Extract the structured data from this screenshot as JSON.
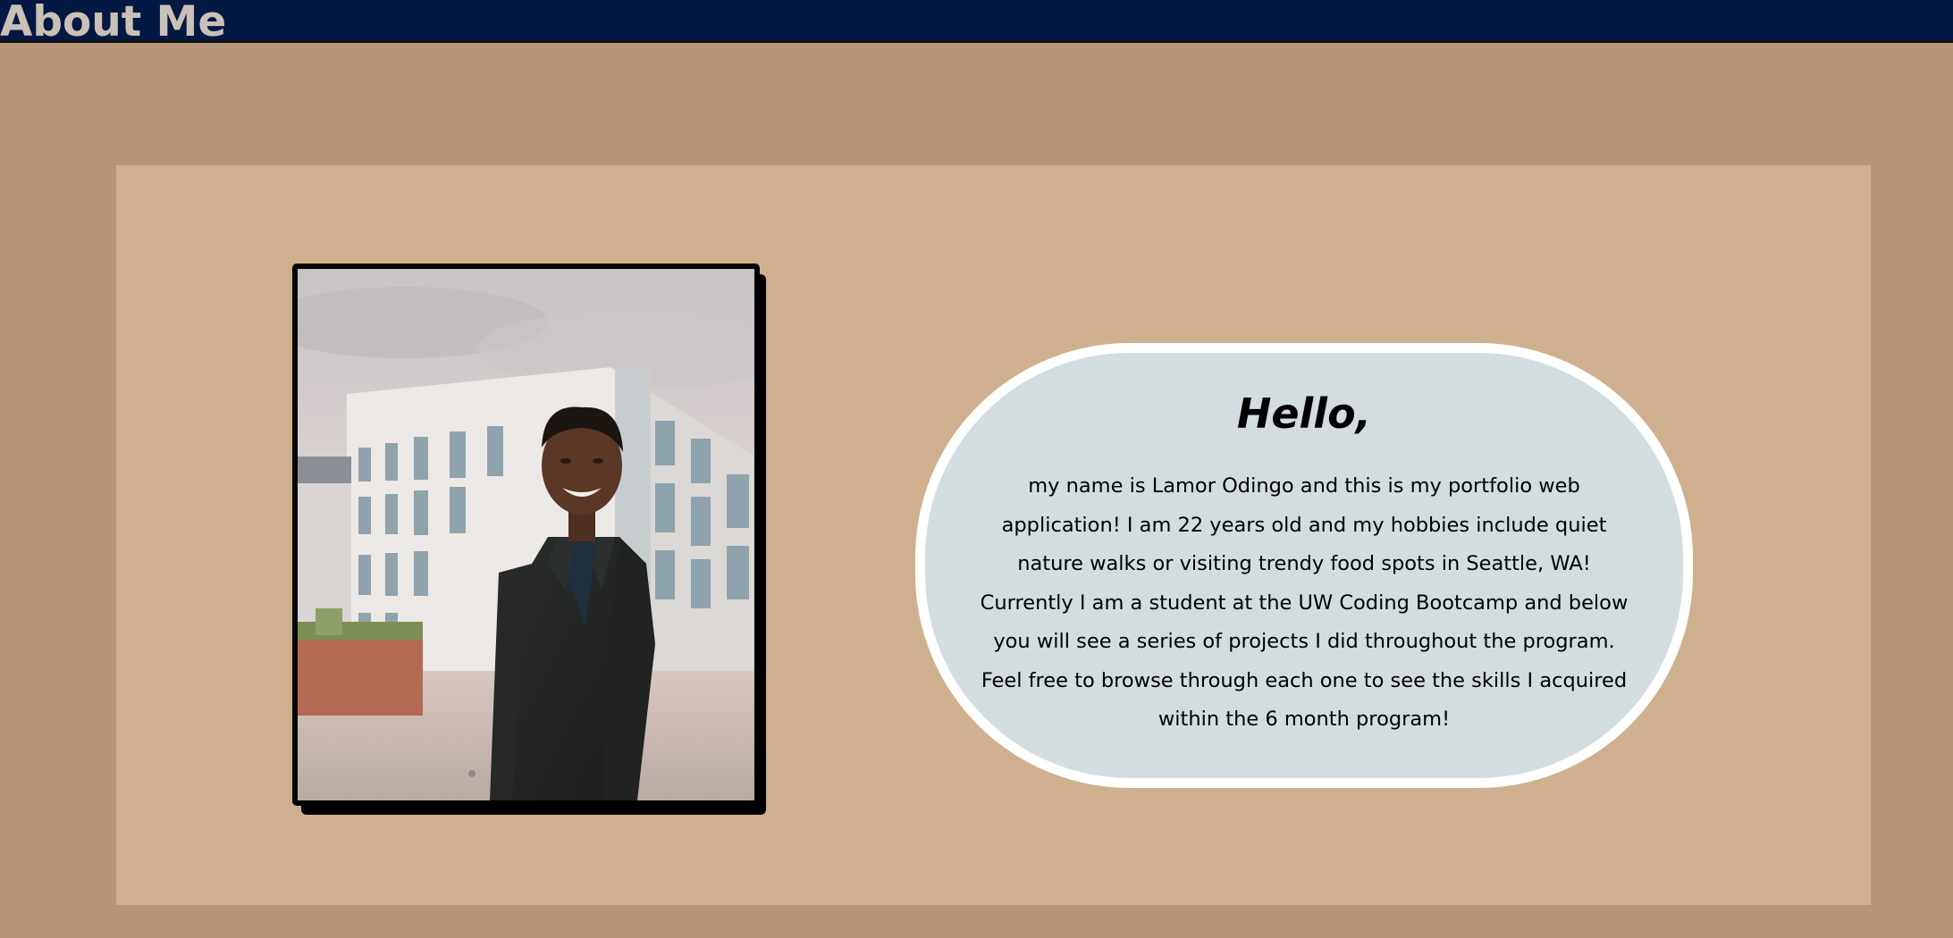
{
  "header": {
    "title": "About Me"
  },
  "profile": {
    "photo_alt": "Portrait of a smiling man in a dark suit standing in front of a modern building"
  },
  "bio": {
    "greeting": "Hello,",
    "text": "my name is Lamor Odingo and this is my portfolio web application! I am 22 years old and my hobbies include quiet nature walks or visiting trendy food spots in Seattle, WA! Currently I am a student at the UW Coding Bootcamp and below you will see a series of projects I did throughout the program. Feel free to browse through each one to see the skills I acquired within the 6 month program!"
  },
  "colors": {
    "header_bg": "#031842",
    "page_bg": "#b89577",
    "panel_bg": "#cfb08e",
    "bubble_bg": "#d3dcde",
    "bubble_border": "#ffffff",
    "title_text": "#c9c0b6"
  }
}
